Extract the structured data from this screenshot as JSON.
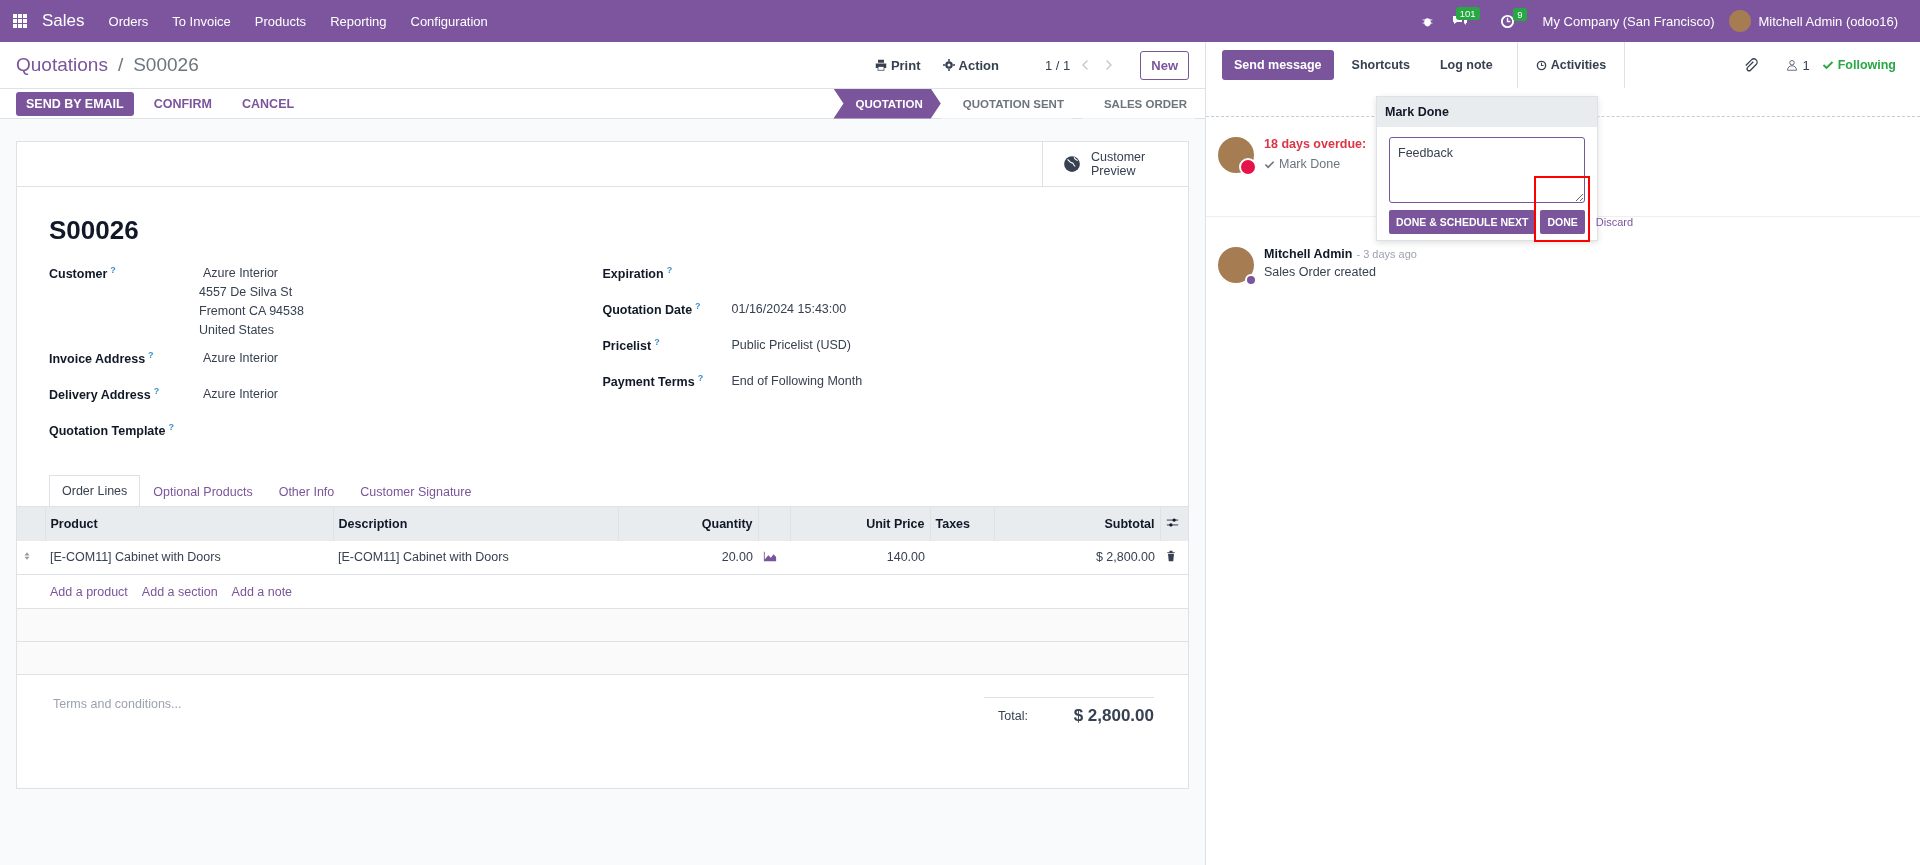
{
  "navbar": {
    "app": "Sales",
    "menu": [
      "Orders",
      "To Invoice",
      "Products",
      "Reporting",
      "Configuration"
    ],
    "messages_count": "101",
    "activities_count": "9",
    "company": "My Company (San Francisco)",
    "user": "Mitchell Admin (odoo16)"
  },
  "control_panel": {
    "breadcrumb": "Quotations",
    "separator": "/",
    "record": "S00026",
    "print": "Print",
    "action": "Action",
    "pager": "1 / 1",
    "new": "New"
  },
  "actions": [
    {
      "label": "SEND BY EMAIL",
      "primary": true
    },
    {
      "label": "CONFIRM",
      "primary": false
    },
    {
      "label": "CANCEL",
      "primary": false
    }
  ],
  "stages": [
    {
      "label": "QUOTATION",
      "selected": true
    },
    {
      "label": "QUOTATION SENT",
      "selected": false
    },
    {
      "label": "SALES ORDER",
      "selected": false
    }
  ],
  "smart_button": {
    "line1": "Customer",
    "line2": "Preview"
  },
  "title": "S00026",
  "left_fields": [
    {
      "label": "Customer",
      "help": "?",
      "lines": [
        "Azure Interior",
        "4557 De Silva St",
        "Fremont CA 94538",
        "United States"
      ]
    },
    {
      "label": "Invoice Address",
      "help": "?",
      "lines": [
        "Azure Interior"
      ]
    },
    {
      "label": "Delivery Address",
      "help": "?",
      "lines": [
        "Azure Interior"
      ]
    },
    {
      "label": "Quotation Template",
      "help": "?"
    }
  ],
  "right_fields": [
    {
      "label": "Expiration",
      "help": "?"
    },
    {
      "label": "Quotation Date",
      "help": "?",
      "lines": [
        "01/16/2024 15:43:00"
      ]
    },
    {
      "label": "Pricelist",
      "help": "?",
      "lines": [
        "Public Pricelist (USD)"
      ]
    },
    {
      "label": "Payment Terms",
      "help": "?",
      "lines": [
        "End of Following Month"
      ]
    }
  ],
  "tabs": [
    {
      "label": "Order Lines",
      "selected": true
    },
    {
      "label": "Optional Products",
      "selected": false
    },
    {
      "label": "Other Info",
      "selected": false
    },
    {
      "label": "Customer Signature",
      "selected": false
    }
  ],
  "table": {
    "columns": [
      "Product",
      "Description",
      "Quantity",
      "Unit Price",
      "Taxes",
      "Subtotal"
    ],
    "rows": [
      {
        "product": "[E-COM11] Cabinet with Doors",
        "description": "[E-COM11] Cabinet with Doors",
        "quantity": "20.00",
        "unit_price": "140.00",
        "subtotal": "$ 2,800.00"
      }
    ],
    "add_links": [
      "Add a product",
      "Add a section",
      "Add a note"
    ]
  },
  "terms_placeholder": "Terms and conditions...",
  "total": {
    "label": "Total:",
    "value": "$ 2,800.00"
  },
  "chatter": {
    "buttons": [
      {
        "label": "Send message",
        "selected": true
      },
      {
        "label": "Shortcuts",
        "selected": false
      },
      {
        "label": "Log note",
        "selected": false
      }
    ],
    "activities": "Activities",
    "followers": "1",
    "following": "Following",
    "activity": {
      "overdue": "18 days overdue:",
      "mark_done": "Mark Done"
    },
    "popover": {
      "title": "Mark Done",
      "feedback": "Feedback",
      "schedule_next": "DONE & SCHEDULE NEXT",
      "done": "DONE",
      "discard": "Discard",
      "done_highlighted": true
    },
    "message": {
      "author": "Mitchell Admin",
      "date": "- 3 days ago",
      "body": "Sales Order created"
    }
  }
}
